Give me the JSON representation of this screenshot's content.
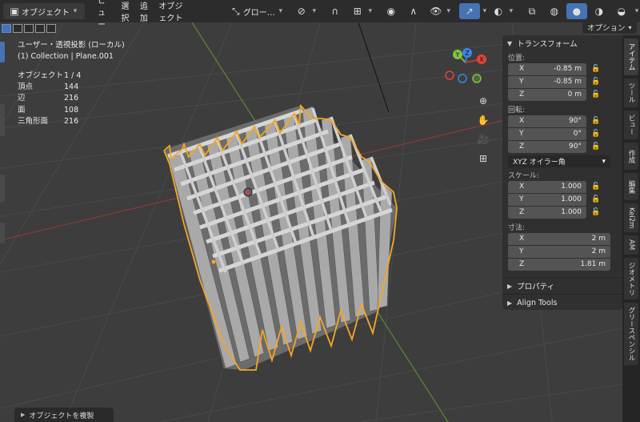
{
  "header": {
    "mode_label": "オブジェクト",
    "menus": [
      "ビュー",
      "選択",
      "追加",
      "オブジェクト"
    ],
    "transform_orientation": "グロー…",
    "options_label": "オプション"
  },
  "overlay": {
    "view_name": "ユーザー・透視投影 (ローカル)",
    "collection": "(1) Collection | Plane.001",
    "stats": [
      {
        "label": "オブジェクト",
        "value": "1 / 4"
      },
      {
        "label": "頂点",
        "value": "144"
      },
      {
        "label": "辺",
        "value": "216"
      },
      {
        "label": "面",
        "value": "108"
      },
      {
        "label": "三角形面",
        "value": "216"
      }
    ]
  },
  "gizmo": {
    "x": "X",
    "y": "Y",
    "z": "Z"
  },
  "npanel": {
    "transform_title": "トランスフォーム",
    "location_label": "位置:",
    "location": [
      {
        "axis": "X",
        "value": "-0.85 m"
      },
      {
        "axis": "Y",
        "value": "-0.85 m"
      },
      {
        "axis": "Z",
        "value": "0 m"
      }
    ],
    "rotation_label": "回転:",
    "rotation": [
      {
        "axis": "X",
        "value": "90°"
      },
      {
        "axis": "Y",
        "value": "0°"
      },
      {
        "axis": "Z",
        "value": "90°"
      }
    ],
    "rotation_mode": "XYZ オイラー角",
    "scale_label": "スケール:",
    "scale": [
      {
        "axis": "X",
        "value": "1.000"
      },
      {
        "axis": "Y",
        "value": "1.000"
      },
      {
        "axis": "Z",
        "value": "1.000"
      }
    ],
    "dimensions_label": "寸法:",
    "dimensions": [
      {
        "axis": "X",
        "value": "2 m"
      },
      {
        "axis": "Y",
        "value": "2 m"
      },
      {
        "axis": "Z",
        "value": "1.81 m"
      }
    ],
    "properties_title": "プロパティ",
    "align_title": "Align Tools"
  },
  "side_tabs": [
    "アイテム",
    "ツール",
    "ビュー",
    "作成",
    "編集",
    "Kei2m",
    "AM",
    "ジオメトリ",
    "グリースペンシル"
  ],
  "bottom_hint": "オブジェクトを複製",
  "colors": {
    "accent": "#4772b3",
    "selection_outline": "#f5a623",
    "x_axis": "#c0392b",
    "y_axis": "#7db53c"
  }
}
